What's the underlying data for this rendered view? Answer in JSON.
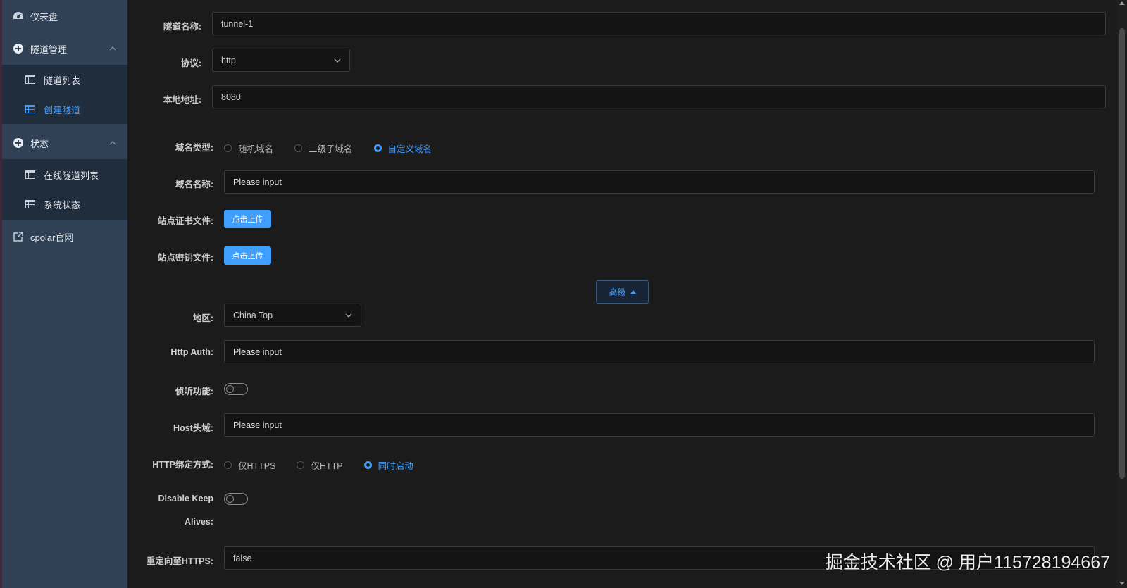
{
  "sidebar": {
    "dashboard": "仪表盘",
    "tunnel_mgmt": "隧道管理",
    "tunnel_list": "隧道列表",
    "create_tunnel": "创建隧道",
    "status": "状态",
    "online_tunnels": "在线隧道列表",
    "system_status": "系统状态",
    "cpolar_site": "cpolar官网"
  },
  "form": {
    "tunnel_name_label": "隧道名称:",
    "tunnel_name_value": "tunnel-1",
    "protocol_label": "协议:",
    "protocol_value": "http",
    "local_addr_label": "本地地址:",
    "local_addr_value": "8080",
    "domain_type_label": "域名类型:",
    "domain_type_options": [
      "随机域名",
      "二级子域名",
      "自定义域名"
    ],
    "domain_type_selected": "自定义域名",
    "domain_name_label": "域名名称:",
    "domain_name_placeholder": "Please input",
    "cert_file_label": "站点证书文件:",
    "key_file_label": "站点密钥文件:",
    "upload_label": "点击上传",
    "advanced_label": "高级",
    "region_label": "地区:",
    "region_value": "China Top",
    "http_auth_label": "Http Auth:",
    "http_auth_placeholder": "Please input",
    "listen_label": "侦听功能:",
    "host_header_label": "Host头域:",
    "host_header_placeholder": "Please input",
    "bind_mode_label": "HTTP绑定方式:",
    "bind_mode_options": [
      "仅HTTPS",
      "仅HTTP",
      "同时启动"
    ],
    "bind_mode_selected": "同时启动",
    "disable_keepalive_label_1": "Disable Keep",
    "disable_keepalive_label_2": "Alives:",
    "redirect_https_label": "重定向至HTTPS:",
    "redirect_https_value": "false"
  },
  "watermark": "掘金技术社区 @ 用户115728194667",
  "colors": {
    "accent": "#409eff",
    "sidebar_bg": "#304156",
    "submenu_bg": "#1f2d3d",
    "page_bg": "#1b1b1c"
  }
}
